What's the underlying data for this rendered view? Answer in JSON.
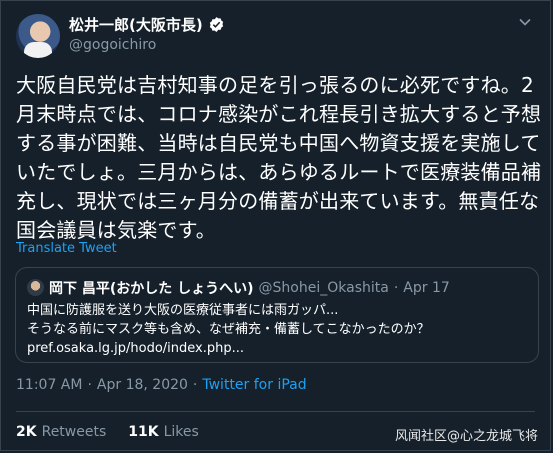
{
  "author": {
    "display_name": "松井一郎(大阪市長)",
    "handle": "@gogoichiro"
  },
  "tweet": {
    "text": "大阪自民党は吉村知事の足を引っ張るのに必死ですね。2月末時点では、コロナ感染がこれ程長引き拡大すると予想する事が困難、当時は自民党も中国へ物資支援を実施していたでしょ。三月からは、あらゆるルートで医療装備品補充し、現状では三ヶ月分の備蓄が出来ています。無責任な国会議員は気楽です。",
    "translate_label": "Translate Tweet"
  },
  "quoted": {
    "display_name": "岡下 昌平(おかした しょうへい)",
    "handle": "@Shohei_Okashita",
    "separator": "·",
    "date": "Apr 17",
    "lines": [
      "中国に防護服を送り大阪の医療従事者には雨ガッパ...",
      "そうなる前にマスク等も含め、なぜ補充・備蓄してこなかったのか？",
      "pref.osaka.lg.jp/hodo/index.php..."
    ]
  },
  "meta": {
    "time": "11:07 AM",
    "separator": "·",
    "date": "Apr 18, 2020",
    "separator2": "·",
    "app": "Twitter for iPad"
  },
  "stats": {
    "retweets_count": "2K",
    "retweets_label": "Retweets",
    "likes_count": "11K",
    "likes_label": "Likes"
  },
  "watermark": "风闻社区@心之龙城飞将",
  "colors": {
    "background": "#15202b",
    "border": "#38444d",
    "secondary_text": "#8899a6",
    "accent": "#1da1f2"
  }
}
